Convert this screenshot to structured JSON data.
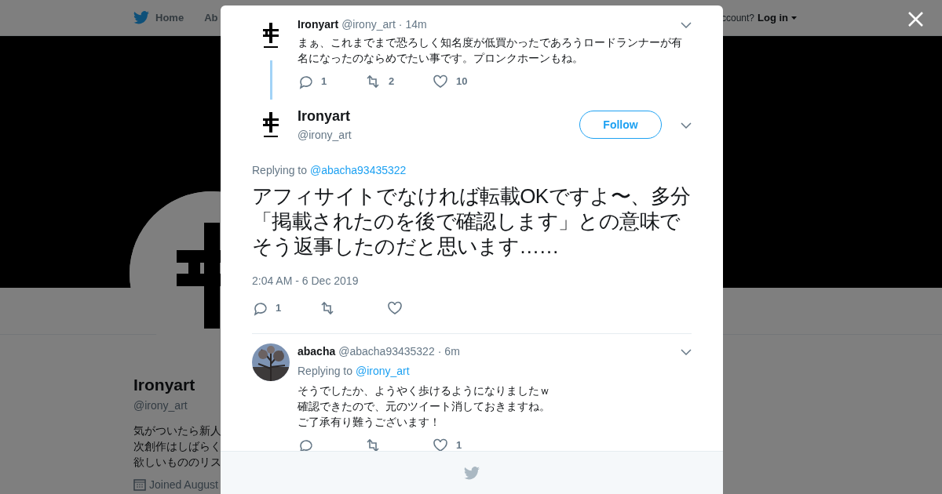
{
  "background": {
    "nav": [
      {
        "label": "Home"
      },
      {
        "label": "Ab"
      }
    ],
    "account_prompt": "ccount?",
    "login": "Log in",
    "profile": {
      "name": "Ironyart",
      "handle": "@irony_art",
      "bio": [
        "気がついたら新人",
        "次創作はしばらく",
        "欲しいもののリス"
      ],
      "joined": "Joined August"
    }
  },
  "thread": [
    {
      "name": "Ironyart",
      "handle": "@irony_art",
      "separator": "·",
      "time": "14m",
      "text": "まぁ、これまでまで恐ろしく知名度が低買かったであろうロードランナーが有名になったのならめでたい事です。プロンクホーンもね。",
      "replies": "1",
      "retweets": "2",
      "likes": "10",
      "liked": false,
      "connector": true
    }
  ],
  "main_tweet": {
    "name": "Ironyart",
    "handle": "@irony_art",
    "follow": "Follow",
    "replying_label": "Replying to",
    "replying_to": "@abacha93435322",
    "text": "アフィサイトでなければ転載OKですよ〜、多分「掲載されたのを後で確認します」との意味でそう返事したのだと思います……",
    "timestamp": "2:04 AM - 6 Dec 2019",
    "replies": "1"
  },
  "replies": [
    {
      "name": "abacha",
      "handle": "@abacha93435322",
      "separator": "·",
      "time": "6m",
      "replying_label": "Replying to",
      "replying_to": "@irony_art",
      "lines": [
        "そうでしたか、ようやく歩けるようになりましたｗ",
        "確認できたので、元のツイート消しておきますね。",
        "ご了承有り難うございます！"
      ],
      "likes": "1"
    }
  ]
}
